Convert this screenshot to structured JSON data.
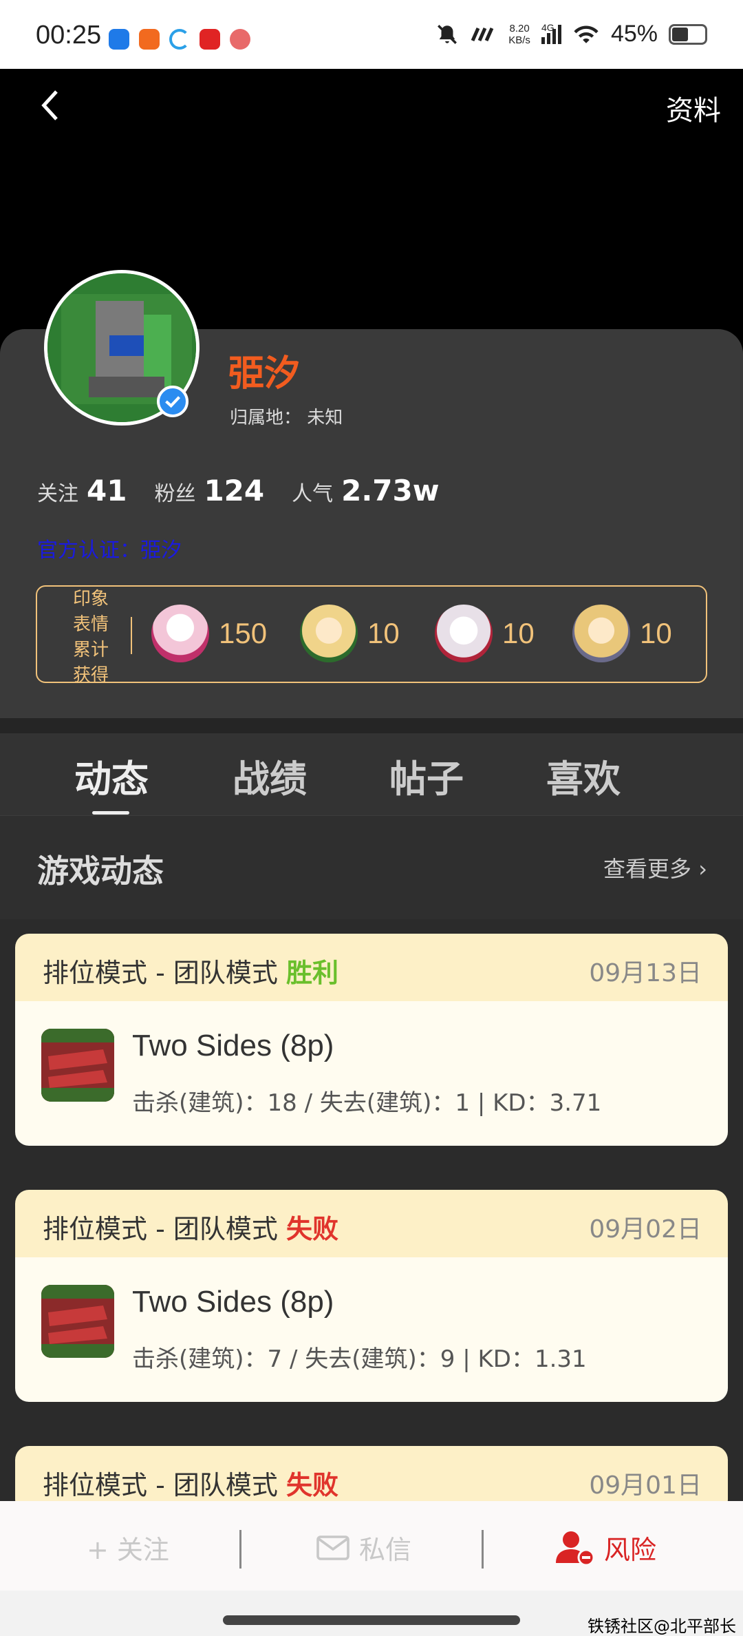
{
  "status_bar": {
    "time": "00:25",
    "net_speed_value": "8.20",
    "net_speed_unit": "KB/s",
    "network": "4G",
    "battery": "45%"
  },
  "header": {
    "profile_link": "资料"
  },
  "profile": {
    "username": "弫汐",
    "location_label": "归属地：",
    "location_value": "未知",
    "following_label": "关注",
    "following_count": "41",
    "fans_label": "粉丝",
    "fans_count": "124",
    "popularity_label": "人气",
    "popularity_count": "2.73w",
    "official_cert": "官方认证：弫汐"
  },
  "emoji_stats": {
    "label": "印象表情累计获得",
    "items": [
      {
        "count": "150",
        "color": "#f3c6d8"
      },
      {
        "count": "10",
        "color": "#f0d48a"
      },
      {
        "count": "10",
        "color": "#e8e0e8"
      },
      {
        "count": "10",
        "color": "#e9c77a"
      }
    ]
  },
  "tabs": [
    {
      "label": "动态",
      "active": true
    },
    {
      "label": "战绩",
      "active": false
    },
    {
      "label": "帖子",
      "active": false
    },
    {
      "label": "喜欢",
      "active": false
    }
  ],
  "section": {
    "title": "游戏动态",
    "more": "查看更多 ›"
  },
  "games": [
    {
      "mode": "排位模式 - 团队模式",
      "result": "胜利",
      "result_color": "#6abf2c",
      "date": "09月13日",
      "map": "Two Sides (8p)",
      "stats": "击杀(建筑)：18 / 失去(建筑)：1 | KD：3.71"
    },
    {
      "mode": "排位模式 - 团队模式",
      "result": "失败",
      "result_color": "#e0342c",
      "date": "09月02日",
      "map": "Two Sides (8p)",
      "stats": "击杀(建筑)：7 / 失去(建筑)：9 | KD：1.31"
    },
    {
      "mode": "排位模式 - 团队模式",
      "result": "失败",
      "result_color": "#e0342c",
      "date": "09月01日",
      "map": "",
      "stats": ""
    }
  ],
  "bottom_bar": {
    "follow": "+ 关注",
    "message": "私信",
    "risk": "风险"
  },
  "watermark": "铁锈社区@北平部长"
}
